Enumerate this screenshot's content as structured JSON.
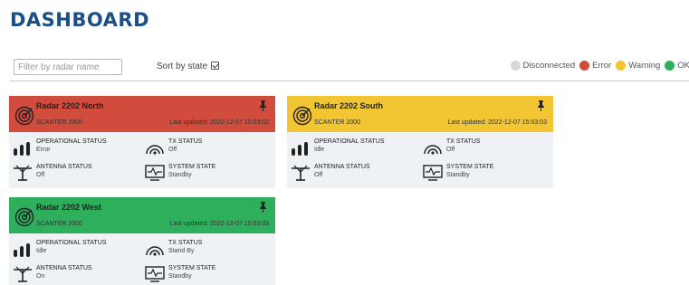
{
  "page": {
    "title": "DASHBOARD"
  },
  "toolbar": {
    "filter_placeholder": "Filter by radar name",
    "sort_label": "Sort by state",
    "sort_checked": true
  },
  "legend": [
    {
      "label": "Disconnected",
      "color": "#d8d8d8"
    },
    {
      "label": "Error",
      "color": "#d24c3e"
    },
    {
      "label": "Warning",
      "color": "#f2c532"
    },
    {
      "label": "OK",
      "color": "#2eaf5c"
    }
  ],
  "radars": [
    {
      "name": "Radar 2202 North",
      "model": "SCANTER 2000",
      "last_updated": "Last updated: 2022-12-07 15:03:02",
      "state_color": "#d24c3e",
      "operational_status_label": "OPERATIONAL STATUS",
      "operational_status": "Error",
      "tx_status_label": "TX STATUS",
      "tx_status": "Off",
      "antenna_status_label": "ANTENNA STATUS",
      "antenna_status": "Off",
      "system_state_label": "SYSTEM STATE",
      "system_state": "Standby"
    },
    {
      "name": "Radar 2202 South",
      "model": "SCANTER 2000",
      "last_updated": "Last updated: 2022-12-07 15:03:03",
      "state_color": "#f2c532",
      "operational_status_label": "OPERATIONAL STATUS",
      "operational_status": "Idle",
      "tx_status_label": "TX STATUS",
      "tx_status": "Off",
      "antenna_status_label": "ANTENNA STATUS",
      "antenna_status": "Off",
      "system_state_label": "SYSTEM STATE",
      "system_state": "Standby"
    },
    {
      "name": "Radar 2202 West",
      "model": "SCANTER 2000",
      "last_updated": "Last updated: 2022-12-07 15:03:03",
      "state_color": "#2eaf5c",
      "operational_status_label": "OPERATIONAL STATUS",
      "operational_status": "Idle",
      "tx_status_label": "TX STATUS",
      "tx_status": "Stand By",
      "antenna_status_label": "ANTENNA STATUS",
      "antenna_status": "On",
      "system_state_label": "SYSTEM STATE",
      "system_state": "Standby"
    }
  ]
}
